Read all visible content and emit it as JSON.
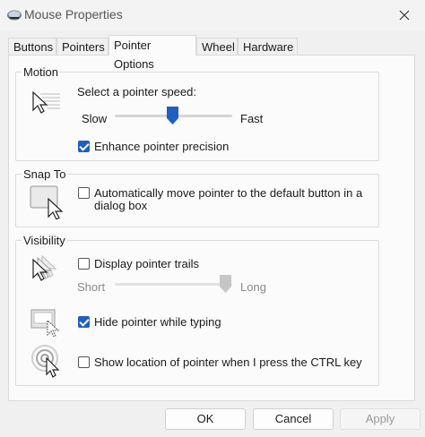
{
  "window": {
    "title": "Mouse Properties"
  },
  "tabs": [
    {
      "label": "Buttons",
      "active": false
    },
    {
      "label": "Pointers",
      "active": false
    },
    {
      "label": "Pointer Options",
      "active": true
    },
    {
      "label": "Wheel",
      "active": false
    },
    {
      "label": "Hardware",
      "active": false
    }
  ],
  "motion": {
    "title": "Motion",
    "speed_label": "Select a pointer speed:",
    "slow_label": "Slow",
    "fast_label": "Fast",
    "speed_position": 0.5,
    "enhance_precision": {
      "label": "Enhance pointer precision",
      "checked": true
    }
  },
  "snap_to": {
    "title": "Snap To",
    "auto_snap": {
      "label_line1": "Automatically move pointer to the default button in a",
      "label_line2": "dialog box",
      "checked": false
    }
  },
  "visibility": {
    "title": "Visibility",
    "trails": {
      "label": "Display pointer trails",
      "checked": false
    },
    "short_label": "Short",
    "long_label": "Long",
    "trail_length_position": 1.0,
    "hide_typing": {
      "label": "Hide pointer while typing",
      "checked": true
    },
    "show_location": {
      "label": "Show location of pointer when I press the CTRL key",
      "checked": false
    }
  },
  "buttons": {
    "ok": "OK",
    "cancel": "Cancel",
    "apply": "Apply"
  },
  "colors": {
    "accent": "#1f5fbf",
    "window_bg": "#f0f0f0",
    "panel_bg": "#fbfbfb"
  }
}
